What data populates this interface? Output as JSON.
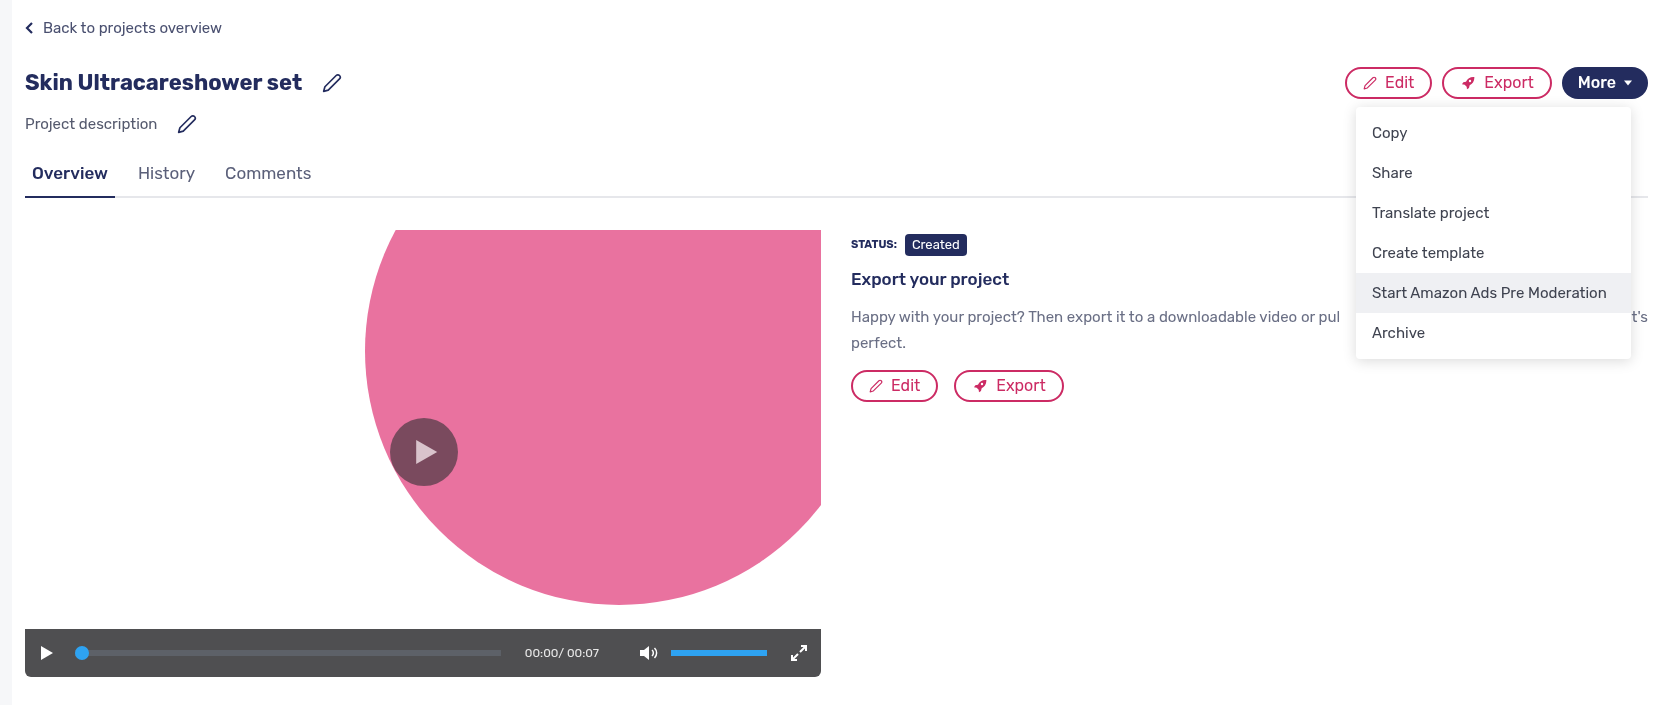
{
  "back_link": "Back to projects overview",
  "project": {
    "title": "Skin Ultracareshower set",
    "description": "Project description"
  },
  "actions": [
    {
      "label": "Edit",
      "kind": "edit"
    },
    {
      "label": "Export",
      "kind": "export"
    },
    {
      "label": "More",
      "kind": "menu"
    }
  ],
  "more_menu": [
    {
      "label": "Copy",
      "selected": false
    },
    {
      "label": "Share",
      "selected": false
    },
    {
      "label": "Translate project",
      "selected": false
    },
    {
      "label": "Create template",
      "selected": false
    },
    {
      "label": "Start Amazon Ads Pre Moderation",
      "selected": true
    },
    {
      "label": "Archive",
      "selected": false
    }
  ],
  "tabs": [
    {
      "label": "Overview",
      "selected": true
    },
    {
      "label": "History",
      "selected": false
    },
    {
      "label": "Comments",
      "selected": false
    }
  ],
  "video": {
    "kind": "picture",
    "progress": {
      "level": 0
    },
    "time": "00:00/ 00:07",
    "volume": {
      "level": 1
    }
  },
  "status": {
    "label": "STATUS:",
    "value": "Created"
  },
  "export_panel": {
    "heading": "Export your project",
    "text_parts": [
      "Happy with your project? Then export it to a downloadable video or pul",
      "t's",
      "perfect."
    ],
    "buttons": [
      {
        "label": "Edit",
        "kind": "edit"
      },
      {
        "label": "Export",
        "kind": "export"
      }
    ]
  }
}
